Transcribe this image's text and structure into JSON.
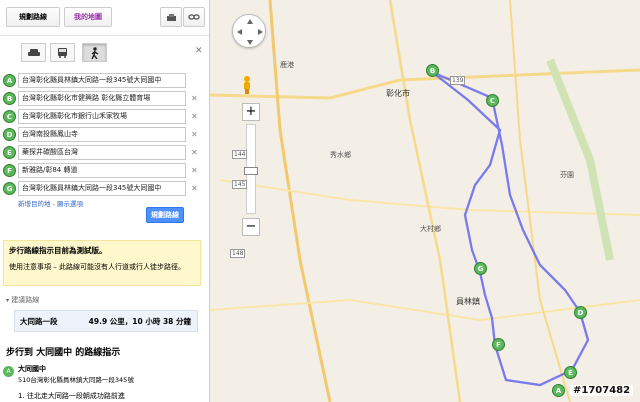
{
  "tabs": {
    "route": "規劃路線",
    "my_maps": "我的地圖"
  },
  "icons": {
    "print": "print-icon",
    "link": "link-icon",
    "car": "car-icon",
    "transit": "bus-icon",
    "walk": "walk-icon",
    "close": "close-icon"
  },
  "colors": {
    "route": "#6d6df0",
    "marker": "#5cb85c",
    "link": "#3366cc",
    "button": "#4d90fe"
  },
  "waypoints": [
    {
      "letter": "A",
      "value": "台灣彰化縣員林鎮大同路一段345號大同國中"
    },
    {
      "letter": "B",
      "value": "台灣彰化縣彰化市健興路 彰化縣立體育場"
    },
    {
      "letter": "C",
      "value": "台灣彰化縣彰化市銀行山禾家牧場"
    },
    {
      "letter": "D",
      "value": "台灣南投縣鳳山寺"
    },
    {
      "letter": "E",
      "value": "藥探井碳酸區台灣"
    },
    {
      "letter": "F",
      "value": "新雅路/彰84 轉道"
    },
    {
      "letter": "G",
      "value": "台灣彰化縣員林鎮大同路一段345號大同國中"
    }
  ],
  "add_destination": "新增目的地 - 顯示選項",
  "plan_button": "規劃路線",
  "notice": {
    "title": "步行路線指示目前為測試版。",
    "body": "使用注意事項 – 此路線可能沒有人行道或行人徒步路徑。"
  },
  "suggested_routes_label": "建議路線",
  "summary": {
    "road": "大同路一段",
    "stats": "49.9 公里，10 小時 38 分鐘"
  },
  "directions_heading": "步行到 大同國中 的路線指示",
  "destination": {
    "name": "大同國中",
    "address": "510台灣彰化縣員林鎮大同路一段345號"
  },
  "first_step": "1. 往北走大同路一段朝成功路前進",
  "map": {
    "markers": [
      "A",
      "B",
      "C",
      "D",
      "E",
      "F",
      "G"
    ],
    "zoom_plus": "+",
    "zoom_minus": "−",
    "labels": [
      "彰化市",
      "員林鎮",
      "大村鄉",
      "芬園",
      "秀水鄉",
      "鹿港"
    ],
    "roads": [
      "139",
      "148",
      "144",
      "145"
    ],
    "watermark": "#1707482"
  }
}
